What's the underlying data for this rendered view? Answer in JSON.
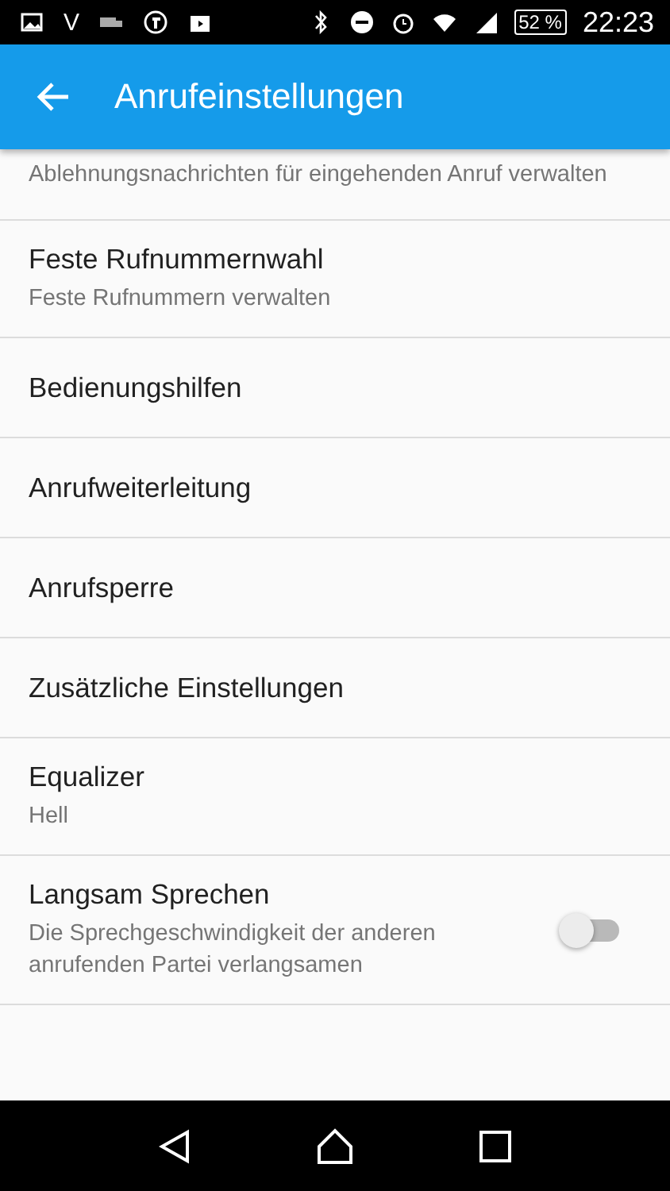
{
  "status_bar": {
    "carrier": "V",
    "battery": "52 %",
    "time": "22:23"
  },
  "app_bar": {
    "title": "Anrufeinstellungen"
  },
  "items": [
    {
      "kind": "partial",
      "subtitle": "Ablehnungsnachrichten für eingehenden Anruf verwalten"
    },
    {
      "kind": "summary",
      "title": "Feste Rufnummernwahl",
      "subtitle": "Feste Rufnummern verwalten"
    },
    {
      "kind": "plain",
      "title": "Bedienungshilfen"
    },
    {
      "kind": "plain",
      "title": "Anrufweiterleitung"
    },
    {
      "kind": "plain",
      "title": "Anrufsperre"
    },
    {
      "kind": "plain",
      "title": "Zusätzliche Einstellungen"
    },
    {
      "kind": "summary",
      "title": "Equalizer",
      "subtitle": "Hell"
    },
    {
      "kind": "switch",
      "title": "Langsam Sprechen",
      "subtitle": "Die Sprechgeschwindigkeit der anderen anrufenden Partei verlangsamen",
      "on": false
    }
  ]
}
